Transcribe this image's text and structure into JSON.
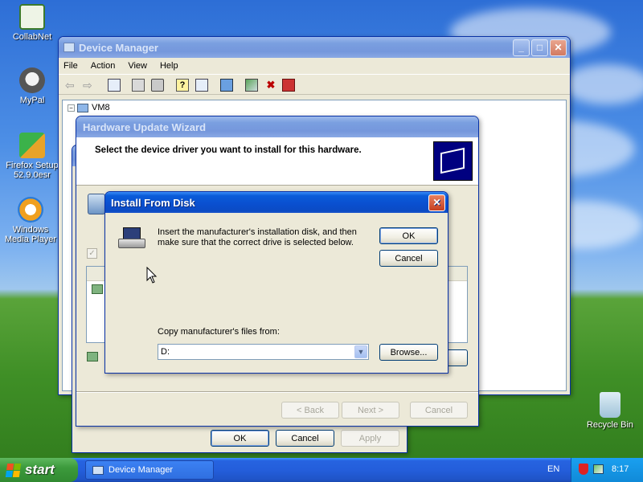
{
  "desktop": {
    "icons": [
      {
        "label": "CollabNet"
      },
      {
        "label": "MyPal"
      },
      {
        "label": "Firefox Setup 52.9.0esr"
      },
      {
        "label": "Windows Media Player"
      },
      {
        "label": "Recycle Bin"
      }
    ]
  },
  "device_manager": {
    "title": "Device Manager",
    "menu": [
      "File",
      "Action",
      "View",
      "Help"
    ],
    "tree_root": "VM8"
  },
  "wizard": {
    "title": "Hardware Update Wizard",
    "heading": "Select the device driver you want to install for this hardware.",
    "back": "< Back",
    "next": "Next >",
    "cancel": "Cancel"
  },
  "properties": {
    "ok": "OK",
    "cancel": "Cancel",
    "apply": "Apply"
  },
  "install_dialog": {
    "title": "Install From Disk",
    "message": "Insert the manufacturer's installation disk, and then make sure that the correct drive is selected below.",
    "ok": "OK",
    "cancel": "Cancel",
    "copy_label": "Copy manufacturer's files from:",
    "path_value": "D:",
    "browse": "Browse..."
  },
  "taskbar": {
    "start": "start",
    "task": "Device Manager",
    "lang": "EN",
    "clock": "8:17"
  }
}
